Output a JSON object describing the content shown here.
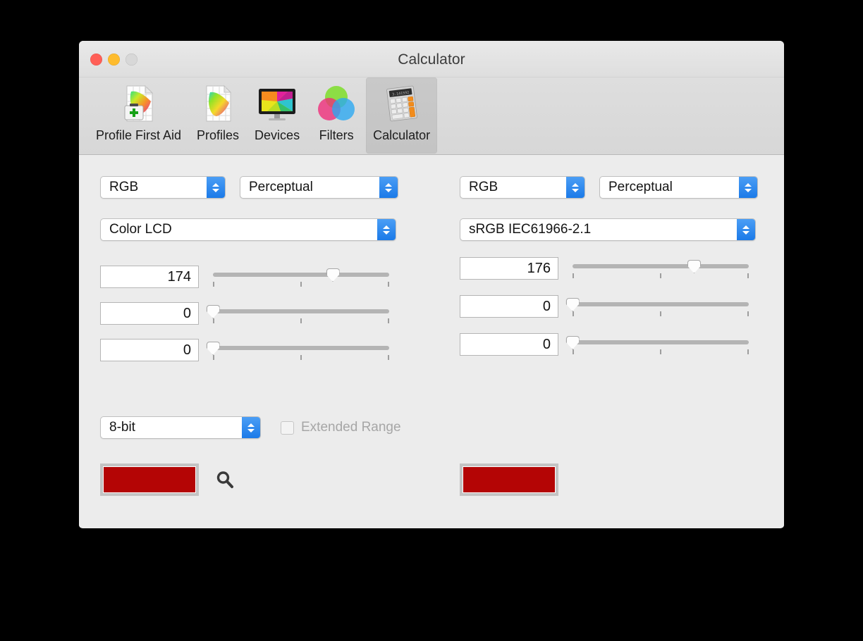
{
  "window": {
    "title": "Calculator",
    "traffic_lights": [
      {
        "name": "close",
        "color": "#ff5f57"
      },
      {
        "name": "minimize",
        "color": "#febc2e"
      },
      {
        "name": "zoom",
        "color": "#d8d8d8"
      }
    ]
  },
  "toolbar": {
    "items": [
      {
        "id": "profile-first-aid",
        "label": "Profile First Aid",
        "icon": "profile-first-aid-icon",
        "selected": false
      },
      {
        "id": "profiles",
        "label": "Profiles",
        "icon": "profiles-icon",
        "selected": false
      },
      {
        "id": "devices",
        "label": "Devices",
        "icon": "devices-icon",
        "selected": false
      },
      {
        "id": "filters",
        "label": "Filters",
        "icon": "filters-icon",
        "selected": false
      },
      {
        "id": "calculator",
        "label": "Calculator",
        "icon": "calculator-icon",
        "selected": true
      }
    ]
  },
  "left": {
    "color_space": "RGB",
    "rendering_intent": "Perceptual",
    "profile": "Color LCD",
    "channels": [
      {
        "name": "red",
        "value": "174",
        "slider_percent": 68
      },
      {
        "name": "green",
        "value": "0",
        "slider_percent": 0
      },
      {
        "name": "blue",
        "value": "0",
        "slider_percent": 0
      }
    ],
    "swatch_color": "#b40505"
  },
  "right": {
    "color_space": "RGB",
    "rendering_intent": "Perceptual",
    "profile": "sRGB IEC61966-2.1",
    "channels": [
      {
        "name": "red",
        "value": "176",
        "slider_percent": 69
      },
      {
        "name": "green",
        "value": "0",
        "slider_percent": 0
      },
      {
        "name": "blue",
        "value": "0",
        "slider_percent": 0
      }
    ],
    "swatch_color": "#b40505"
  },
  "bottom": {
    "bit_depth": "8-bit",
    "extended_range_label": "Extended Range",
    "extended_range_checked": false,
    "extended_range_enabled": false,
    "loupe_icon": "magnifier-icon"
  },
  "slider_ticks_percent": [
    0,
    50,
    100
  ]
}
